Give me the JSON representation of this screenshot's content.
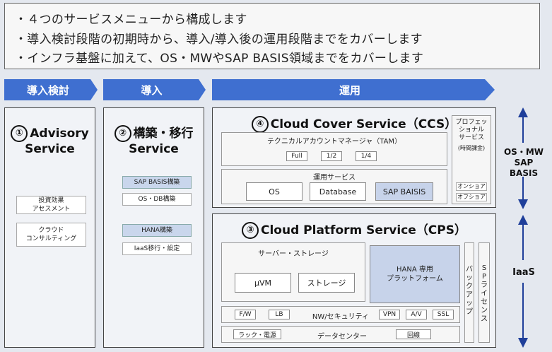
{
  "bullets": [
    "・４つのサービスメニューから構成します",
    "・導入検討段階の初期時から、導入/導入後の運用段階までをカバーします",
    "・インフラ基盤に加えて、OS・MWやSAP BASIS領域までをカバーします"
  ],
  "phases": [
    "導入検討",
    "導入",
    "運用"
  ],
  "advisory": {
    "num": "①",
    "title_line1": "Advisory",
    "title_line2": "Service",
    "items": [
      "投資効果\nアセスメント",
      "クラウド\nコンサルティング"
    ]
  },
  "migration": {
    "num": "②",
    "title_line1": "構築・移行",
    "title_line2": "Service",
    "items": [
      "SAP BASIS構築",
      "OS・DB構築",
      "HANA構築",
      "IaaS移行・設定"
    ]
  },
  "ccs": {
    "num": "④",
    "title": "Cloud Cover Service（CCS）",
    "tam_label": "テクニカルアカウントマネージャ（TAM）",
    "tam_levels": [
      "Full",
      "1/2",
      "1/4"
    ],
    "ops_label": "運用サービス",
    "ops_items": [
      "OS",
      "Database",
      "SAP BAISIS"
    ],
    "pro_label": "プロフェッ\nショナル\nサービス",
    "pro_note": "(時間課金)",
    "pro_items": [
      "オンショア",
      "オフショア"
    ]
  },
  "cps": {
    "num": "③",
    "title": "Cloud Platform Service（CPS）",
    "server_label": "サーバー・ストレージ",
    "server_items": [
      "μVM",
      "ストレージ"
    ],
    "hana_label": "HANA 専用\nプラットフォーム",
    "backup_label": "バックアップ",
    "sp_label": "SPライセンス",
    "nw_items_left": [
      "F/W",
      "LB"
    ],
    "nw_label": "NW/セキュリティ",
    "nw_items_right": [
      "VPN",
      "A/V",
      "SSL"
    ],
    "dc_left": "ラック・電源",
    "dc_label": "データセンター",
    "dc_right": "回線"
  },
  "side_labels": {
    "upper_line1": "OS・MW",
    "upper_line2": "SAP BASIS",
    "lower": "IaaS"
  },
  "colors": {
    "arrow_blue": "#3f6fd0",
    "chip_blue": "#c9d6ec",
    "side_arrow": "#1f3f9a"
  }
}
